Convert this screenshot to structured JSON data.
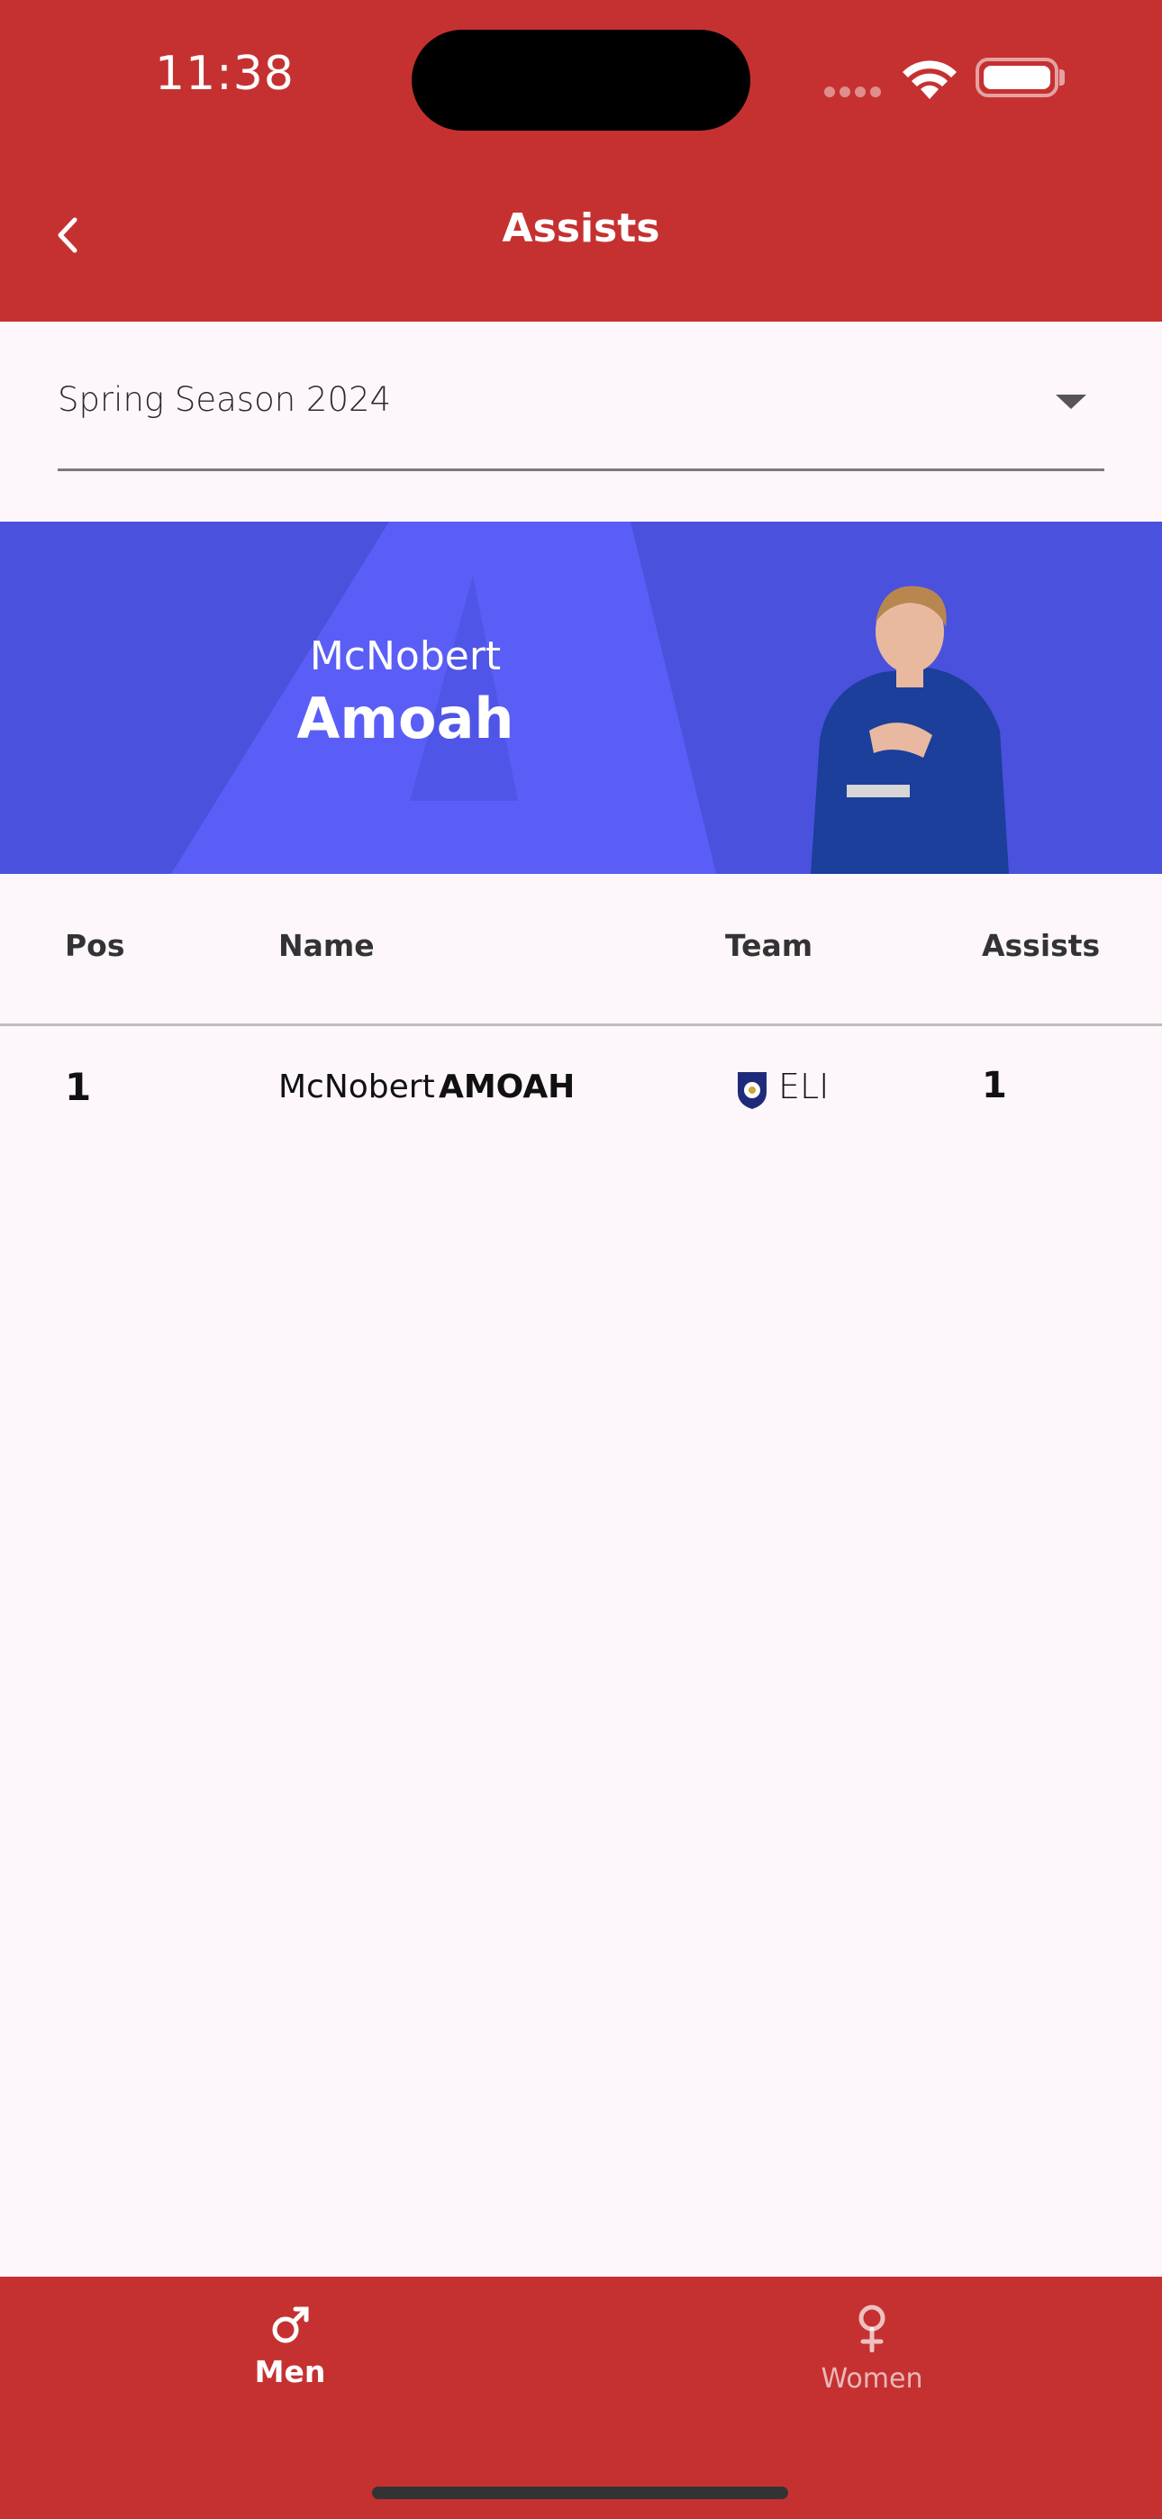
{
  "status_bar": {
    "time": "11:38"
  },
  "header": {
    "title": "Assists"
  },
  "season_selector": {
    "value": "Spring Season 2024"
  },
  "banner": {
    "first_name": "McNobert",
    "last_name": "Amoah"
  },
  "table": {
    "headers": {
      "pos": "Pos",
      "name": "Name",
      "team": "Team",
      "assists": "Assists"
    },
    "rows": [
      {
        "pos": "1",
        "first_name": "McNobert",
        "last_name": "AMOAH",
        "team": "ELI",
        "assists": "1"
      }
    ]
  },
  "bottom_nav": {
    "items": [
      {
        "label": "Men",
        "icon": "male-icon",
        "active": true
      },
      {
        "label": "Women",
        "icon": "female-icon",
        "active": false
      }
    ]
  },
  "colors": {
    "header": "#c53131",
    "banner": "#4a51dc",
    "background": "#fdf7fc"
  }
}
